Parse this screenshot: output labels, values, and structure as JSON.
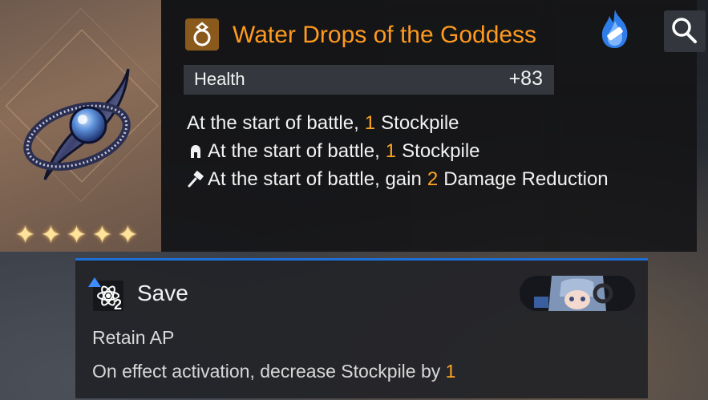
{
  "item": {
    "name": "Water Drops of the Goddess",
    "rarity_stars": 5,
    "stat": {
      "label": "Health",
      "value": "+83"
    },
    "effects": [
      {
        "icon": "none",
        "prefix": "At the start of battle,",
        "number": "1",
        "suffix": "Stockpile"
      },
      {
        "icon": "helmet-icon",
        "prefix": "At the start of battle,",
        "number": "1",
        "suffix": "Stockpile"
      },
      {
        "icon": "hammer-icon",
        "prefix": "At the start of battle, gain",
        "number": "2",
        "suffix": "Damage Reduction"
      }
    ]
  },
  "skill": {
    "name": "Save",
    "level": "2",
    "lines": [
      {
        "text": "Retain AP",
        "number": ""
      },
      {
        "text": "On effect activation, decrease Stockpile by",
        "number": "1"
      }
    ]
  },
  "colors": {
    "title": "#ff9a1e",
    "highlight_number": "#ffa41f",
    "skill_accent": "#1e6fd6",
    "star": "#ffe39a"
  }
}
